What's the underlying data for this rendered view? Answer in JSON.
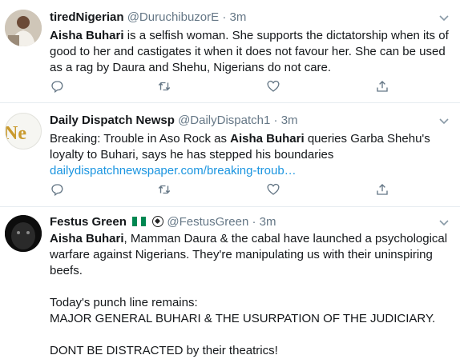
{
  "tweets": [
    {
      "name": "tiredNigerian",
      "handle": "@DuruchibuzorE",
      "time": "3m",
      "body": {
        "bold": "Aisha Buhari",
        "text": " is a selfish woman. She supports the dictatorship when its of good to her and castigates it when it does not favour her. She can be used as a rag by Daura and Shehu, Nigerians do not care."
      }
    },
    {
      "name": "Daily Dispatch Newsp",
      "handle": "@DailyDispatch1",
      "time": "3m",
      "avatar_text": "Ne",
      "body": {
        "pre": "Breaking: Trouble in Aso Rock as ",
        "bold": "Aisha Buhari",
        "post": " queries Garba Shehu's loyalty to Buhari, says he has stepped his boundaries",
        "link": "dailydispatchnewspaper.com/breaking-troub…"
      }
    },
    {
      "name": "Festus Green",
      "handle": "@FestusGreen",
      "time": "3m",
      "body": {
        "bold": "Aisha Buhari",
        "text": ", Mamman Daura & the cabal  have launched a psychological warfare against Nigerians. They're manipulating us with their uninspiring beefs.",
        "para2": "Today's punch line remains:",
        "para3": "MAJOR GENERAL BUHARI & THE USURPATION OF THE JUDICIARY.",
        "para4": "DONT BE DISTRACTED by their theatrics!"
      }
    }
  ],
  "separator": "·",
  "icons": [
    "reply-icon",
    "retweet-icon",
    "like-icon",
    "share-icon",
    "chevron-down-icon"
  ],
  "colors": {
    "link": "#1b95e0",
    "muted": "#657786",
    "border": "#e6ecf0",
    "flag_green": "#008751"
  }
}
